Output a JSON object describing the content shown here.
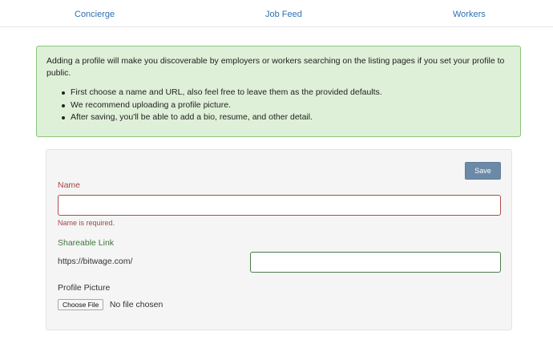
{
  "nav": {
    "concierge": "Concierge",
    "job_feed": "Job Feed",
    "workers": "Workers"
  },
  "alert": {
    "intro": "Adding a profile will make you discoverable by employers or workers searching on the listing pages if you set your profile to public.",
    "items": [
      "First choose a name and URL, also feel free to leave them as the provided defaults.",
      "We recommend uploading a profile picture.",
      "After saving, you'll be able to add a bio, resume, and other detail."
    ]
  },
  "form": {
    "save_label": "Save",
    "name_label": "Name",
    "name_value": "",
    "name_error": "Name is required.",
    "link_label": "Shareable Link",
    "link_prefix": "https://bitwage.com/",
    "link_value": "",
    "picture_label": "Profile Picture",
    "choose_file_label": "Choose File",
    "file_status": "No file chosen"
  },
  "colors": {
    "link": "#2f6fb3",
    "alert_bg": "#dff0d8",
    "alert_border": "#89c47a",
    "error": "#a94442",
    "success": "#3c763d",
    "save_button": "#6c8aa8"
  }
}
